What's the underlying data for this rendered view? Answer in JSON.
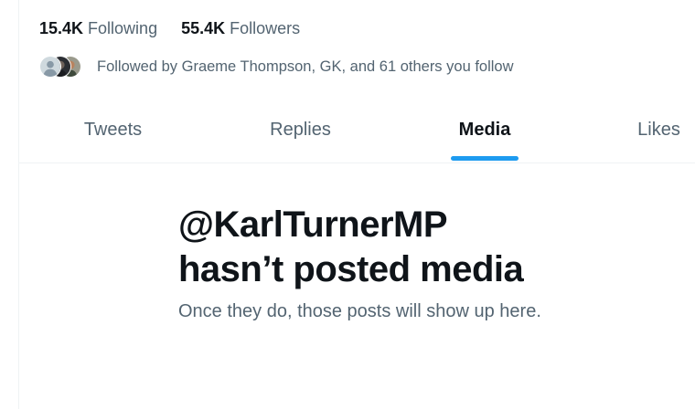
{
  "profile": {
    "following": {
      "count": "15.4K",
      "label": "Following"
    },
    "followers": {
      "count": "55.4K",
      "label": "Followers"
    },
    "followed_by_text": "Followed by Graeme Thompson, GK, and 61 others you follow"
  },
  "tabs": [
    {
      "label": "Tweets",
      "active": false
    },
    {
      "label": "Replies",
      "active": false
    },
    {
      "label": "Media",
      "active": true
    },
    {
      "label": "Likes",
      "active": false
    }
  ],
  "empty_state": {
    "title_line1": "@KarlTurnerMP",
    "title_line2": "hasn’t posted media",
    "subtitle": "Once they do, those posts will show up here."
  },
  "colors": {
    "accent": "#1d9bf0",
    "primary_text": "#0f1419",
    "secondary_text": "#536471",
    "border": "#eff3f4"
  }
}
